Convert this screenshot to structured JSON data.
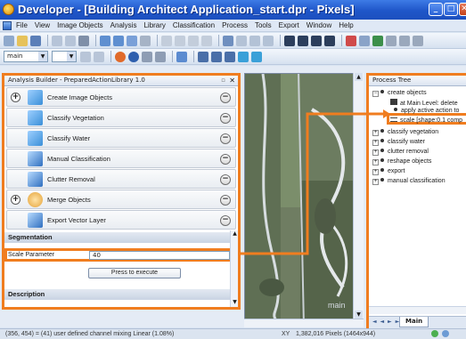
{
  "window": {
    "title": "Developer - [Building Architect Application_start.dpr - Pixels]",
    "minimize_glyph": "_",
    "maximize_glyph": "□",
    "close_glyph": "✕"
  },
  "menu": [
    "File",
    "View",
    "Image Objects",
    "Analysis",
    "Library",
    "Classification",
    "Process",
    "Tools",
    "Export",
    "Window",
    "Help"
  ],
  "toolbar": {
    "view_select": "main",
    "select_arrow": "▼"
  },
  "builder": {
    "title": "Analysis Builder - PreparedActionLibrary 1.0",
    "pin_glyph": "▫",
    "close_glyph": "✕",
    "actions": [
      {
        "label": "Create Image Objects",
        "expander": "+",
        "icon": "create-objects-icon",
        "color": "#3a8fd8"
      },
      {
        "label": "Classify Vegetation",
        "expander": "",
        "icon": "classify-vegetation-icon",
        "color": "#3a8fd8"
      },
      {
        "label": "Classify Water",
        "expander": "",
        "icon": "classify-water-icon",
        "color": "#3a8fd8"
      },
      {
        "label": "Manual Classification",
        "expander": "",
        "icon": "manual-classification-icon",
        "color": "#3a8fd8"
      },
      {
        "label": "Clutter Removal",
        "expander": "",
        "icon": "clutter-removal-icon",
        "color": "#3a8fd8"
      },
      {
        "label": "Merge Objects",
        "expander": "+",
        "icon": "merge-objects-icon",
        "color": "#e5a33a"
      },
      {
        "label": "Export Vector Layer",
        "expander": "",
        "icon": "export-vector-icon",
        "color": "#3a8fd8"
      }
    ],
    "remove_glyph": "−",
    "segmentation_label": "Segmentation",
    "parameter_label": "Scale Parameter",
    "parameter_value": "40",
    "execute_label": "Press to execute",
    "description_label": "Description"
  },
  "map": {
    "label": "main",
    "scroll_up": "▲",
    "scroll_down": "▼"
  },
  "process_tree": {
    "title": "Process Tree",
    "items": [
      {
        "text": "create objects",
        "toggle": "−",
        "indent": 0
      },
      {
        "text": "at Main Level: delete",
        "toggle": "",
        "indent": 1
      },
      {
        "text": "apply active action to",
        "toggle": "",
        "indent": 1
      },
      {
        "text": "scale [shape:0.1 comp",
        "toggle": "",
        "indent": 1
      },
      {
        "text": "classify vegetation",
        "toggle": "+",
        "indent": 0
      },
      {
        "text": "classify water",
        "toggle": "+",
        "indent": 0
      },
      {
        "text": "clutter removal",
        "toggle": "+",
        "indent": 0
      },
      {
        "text": "reshape objects",
        "toggle": "+",
        "indent": 0
      },
      {
        "text": "export",
        "toggle": "+",
        "indent": 0
      },
      {
        "text": "manual classification",
        "toggle": "+",
        "indent": 0
      }
    ],
    "tab_label": "Main",
    "nav_glyphs": "◄ ◄ ► ►"
  },
  "status": {
    "left": "(356, 454) = (41) user defined channel mixing   Linear (1.08%)",
    "middle": "XY",
    "right": "1,382,016 Pixels (1464x944)"
  },
  "colors": {
    "highlight": "#f07d1f",
    "title_bar": "#1f56c9"
  }
}
